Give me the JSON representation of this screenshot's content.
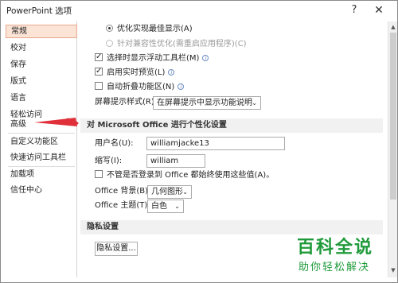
{
  "window": {
    "title": "PowerPoint 选项",
    "help": "?",
    "close": "✕"
  },
  "sidebar": {
    "items": [
      {
        "label": "常规"
      },
      {
        "label": "校对"
      },
      {
        "label": "保存"
      },
      {
        "label": "版式"
      },
      {
        "label": "语言"
      },
      {
        "label": "轻松访问"
      },
      {
        "label": "高级"
      },
      {
        "label": "自定义功能区"
      },
      {
        "label": "快速访问工具栏"
      },
      {
        "label": "加载项"
      },
      {
        "label": "信任中心"
      }
    ],
    "selected": "常规"
  },
  "options": {
    "radio_best_display": "优化实现最佳显示(A)",
    "radio_compat": "针对兼容性优化(需重启应用程序)(C)",
    "cb_mini_toolbar": "选择时显示浮动工具栏(M)",
    "cb_live_preview": "启用实时预览(L)",
    "cb_collapse_ribbon": "自动折叠功能区(N)",
    "screentip_label": "屏幕提示样式(R):",
    "screentip_value": "在屏幕提示中显示功能说明"
  },
  "personalize": {
    "header": "对 Microsoft Office 进行个性化设置",
    "username_label": "用户名(U):",
    "username_value": "williamjacke13",
    "initials_label": "缩写(I):",
    "initials_value": "william",
    "always_use": "不管是否登录到 Office 都始终使用这些值(A)。",
    "background_label": "Office 背景(B):",
    "background_value": "几何图形",
    "theme_label": "Office 主题(T):",
    "theme_value": "白色"
  },
  "privacy": {
    "header": "隐私设置",
    "button": "隐私设置..."
  },
  "watermark": {
    "main": "百科全说",
    "sub": "助你轻松解决"
  },
  "colors": {
    "selected_bg": "#fbe3d6",
    "arrow": "#e0303a",
    "watermark": "#1f9a3a"
  }
}
